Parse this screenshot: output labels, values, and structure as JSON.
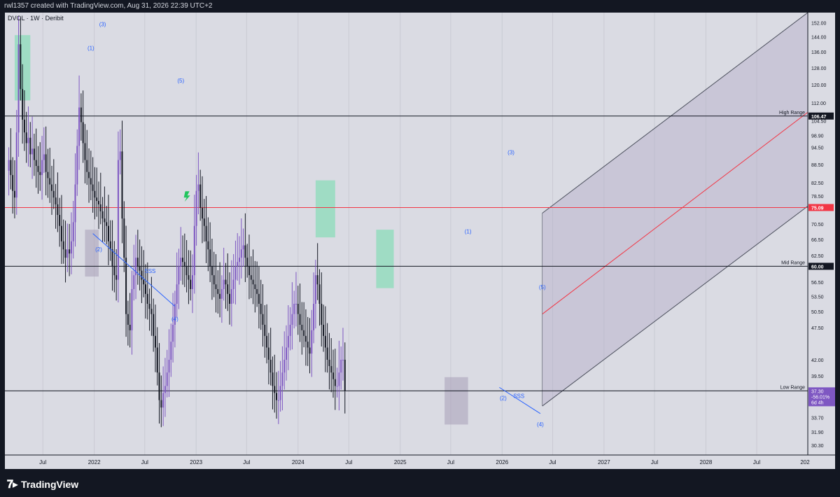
{
  "header": {
    "created_by": "rwl1357 created with TradingView.com, Aug 31, 2026 22:39 UTC+2"
  },
  "symbol_label": "DVOL · 1W · Deribit",
  "branding": {
    "logo_text": "TradingView"
  },
  "chart_data": {
    "type": "candlestick",
    "title": "DVOL · 1W · Deribit",
    "series_name": "DVOL",
    "y_scale": "log",
    "ylim": [
      29.2,
      158
    ],
    "xlim": [
      "2021-02-15",
      "2028-12-31"
    ],
    "y_ticks": [
      "152.00",
      "144.00",
      "136.00",
      "128.00",
      "120.00",
      "112.00",
      "104.50",
      "98.90",
      "94.50",
      "88.50",
      "82.50",
      "78.50",
      "75.09",
      "70.50",
      "66.50",
      "62.50",
      "60.00",
      "56.50",
      "53.50",
      "50.50",
      "47.50",
      "42.00",
      "39.50",
      "37.30",
      "33.70",
      "31.90",
      "30.30"
    ],
    "x_ticks": [
      {
        "label": "Jul",
        "date": "2021-07-01"
      },
      {
        "label": "2022",
        "date": "2022-01-01"
      },
      {
        "label": "Jul",
        "date": "2022-07-01"
      },
      {
        "label": "2023",
        "date": "2023-01-01"
      },
      {
        "label": "Jul",
        "date": "2023-07-01"
      },
      {
        "label": "2024",
        "date": "2024-01-01"
      },
      {
        "label": "Jul",
        "date": "2024-07-01"
      },
      {
        "label": "2025",
        "date": "2025-01-01"
      },
      {
        "label": "Jul",
        "date": "2025-07-01"
      },
      {
        "label": "2026",
        "date": "2026-01-01"
      },
      {
        "label": "Jul",
        "date": "2026-07-01"
      },
      {
        "label": "2027",
        "date": "2027-01-01"
      },
      {
        "label": "Jul",
        "date": "2027-07-01"
      },
      {
        "label": "2028",
        "date": "2028-01-01"
      },
      {
        "label": "Jul",
        "date": "2028-07-01"
      },
      {
        "label": "202",
        "date": "2029-01-01"
      }
    ],
    "start_date": "2021-03-01",
    "closes": [
      90,
      85,
      80,
      78,
      100,
      140,
      118,
      105,
      100,
      96,
      98,
      92,
      94,
      90,
      88,
      86,
      85,
      90,
      92,
      86,
      84,
      82,
      80,
      78,
      76,
      73,
      70,
      66,
      64,
      62,
      64,
      63,
      66,
      71,
      82,
      95,
      110,
      104,
      96,
      90,
      86,
      84,
      82,
      80,
      78,
      77,
      76,
      74,
      72,
      71,
      70,
      66,
      64,
      60,
      58,
      57,
      90,
      93,
      72,
      62,
      50,
      48,
      47,
      55,
      58,
      62,
      60,
      59,
      57,
      56,
      54,
      52,
      51,
      50,
      46,
      44,
      40,
      36,
      35,
      37,
      38,
      40,
      42,
      45,
      48,
      52,
      56,
      60,
      62,
      61,
      60,
      58,
      57,
      55,
      58,
      70,
      80,
      82,
      75,
      72,
      70,
      66,
      64,
      60,
      58,
      56,
      55,
      54,
      53,
      55,
      57,
      56,
      54,
      52,
      55,
      57,
      60,
      61,
      62,
      64,
      65,
      62,
      60,
      58,
      57,
      56,
      55,
      54,
      52,
      50,
      48,
      46,
      44,
      42,
      40,
      38,
      37,
      36,
      36,
      38,
      40,
      42,
      44,
      46,
      48,
      50,
      52,
      52,
      50,
      48,
      47,
      46,
      45,
      44,
      43,
      47,
      52,
      58,
      56,
      52,
      48,
      46,
      44,
      42,
      41,
      40,
      39,
      38,
      38,
      40,
      42,
      42,
      37.3
    ],
    "levels": [
      {
        "label": "High Range",
        "value": 106.47,
        "tag": "106.47",
        "color": "#131722"
      },
      {
        "label": "",
        "value": 75.09,
        "tag": "75.09",
        "color": "#f23645"
      },
      {
        "label": "Mid Range",
        "value": 60.0,
        "tag": "60.00",
        "color": "#131722"
      },
      {
        "label": "Low Range",
        "value": 37.3,
        "tag": "",
        "color": "#131722"
      }
    ],
    "last_price": {
      "value": "37.30",
      "change": "-56.01%",
      "countdown": "6d 4h",
      "color": "#7e57c2"
    },
    "wave_labels": [
      {
        "text": "(1)",
        "date": "2021-12-20",
        "value": 137
      },
      {
        "text": "(3)",
        "date": "2022-01-31",
        "value": 150
      },
      {
        "text": "(5)",
        "date": "2022-11-07",
        "value": 121
      },
      {
        "text": "(2)",
        "date": "2022-01-17",
        "value": 63.5
      },
      {
        "text": "(4)",
        "date": "2022-10-17",
        "value": 48.7
      },
      {
        "text": "SSS",
        "date": "2022-07-20",
        "value": 58.5
      },
      {
        "text": "(1)",
        "date": "2025-09-01",
        "value": 68
      },
      {
        "text": "(3)",
        "date": "2026-02-02",
        "value": 92
      },
      {
        "text": "(5)",
        "date": "2026-05-25",
        "value": 55
      },
      {
        "text": "(2)",
        "date": "2026-01-05",
        "value": 36
      },
      {
        "text": "(4)",
        "date": "2026-05-18",
        "value": 32.6
      },
      {
        "text": "SSS",
        "date": "2026-03-02",
        "value": 36.3
      }
    ],
    "zones": [
      {
        "type": "green",
        "from": "2021-03-22",
        "to": "2021-05-17",
        "high": 145,
        "low": 113
      },
      {
        "type": "purple",
        "from": "2021-11-29",
        "to": "2022-01-17",
        "high": 69,
        "low": 57.7
      },
      {
        "type": "green",
        "from": "2024-03-04",
        "to": "2024-05-13",
        "high": 83.3,
        "low": 67
      },
      {
        "type": "green",
        "from": "2024-10-07",
        "to": "2024-12-09",
        "high": 69,
        "low": 55.2
      },
      {
        "type": "purple",
        "from": "2025-06-09",
        "to": "2025-09-01",
        "high": 39.3,
        "low": 32.8
      },
      {
        "type": "purple",
        "from": "2026-05-25",
        "to": "2028-12-31",
        "high": 74,
        "low": 35
      }
    ],
    "channel": {
      "start_date": "2026-05-25",
      "end_date": "2028-12-31",
      "lower_start": 35.2,
      "lower_end": 75.5,
      "mid_start": 50.0,
      "mid_end": 108,
      "upper_start": 73.5,
      "upper_end": 158
    }
  }
}
